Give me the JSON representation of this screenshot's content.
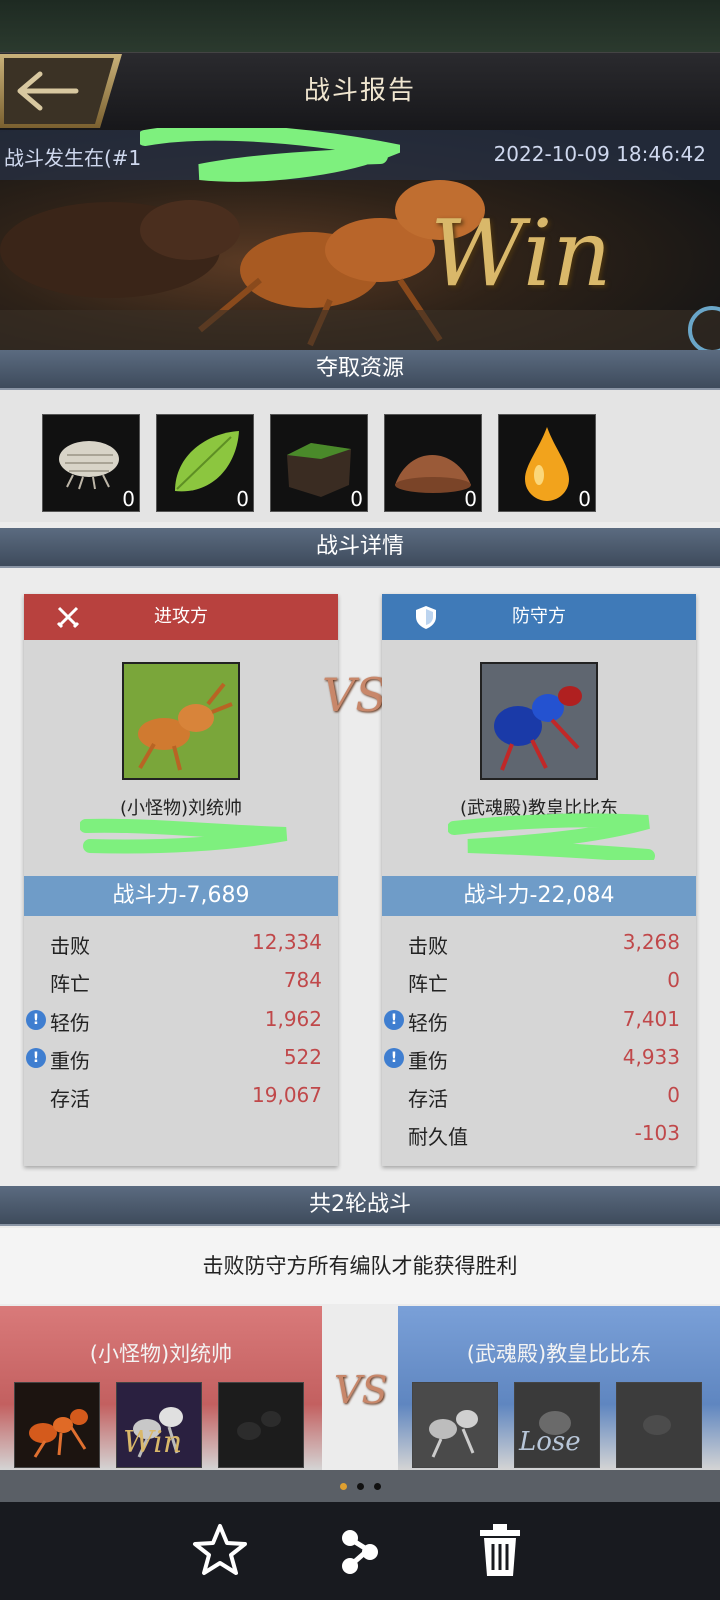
{
  "header": {
    "title": "战斗报告"
  },
  "battle": {
    "location": "战斗发生在(#1",
    "time": "2022-10-09 18:46:42",
    "result_banner": "Win"
  },
  "sections": {
    "loot": "夺取资源",
    "details": "战斗详情",
    "rounds": "共2轮战斗"
  },
  "resources": [
    {
      "icon": "pillbug-icon",
      "count": "0"
    },
    {
      "icon": "leaf-icon",
      "count": "0"
    },
    {
      "icon": "soil-icon",
      "count": "0"
    },
    {
      "icon": "sand-icon",
      "count": "0"
    },
    {
      "icon": "honeydew-drop-icon",
      "count": "0"
    }
  ],
  "attacker": {
    "side_label": "进攻方",
    "name": "(小怪物)刘统帅",
    "power": "战斗力-7,689",
    "stats": [
      {
        "label": "击败",
        "value": "12,334",
        "warn": false
      },
      {
        "label": "阵亡",
        "value": "784",
        "warn": false
      },
      {
        "label": "轻伤",
        "value": "1,962",
        "warn": true
      },
      {
        "label": "重伤",
        "value": "522",
        "warn": true
      },
      {
        "label": "存活",
        "value": "19,067",
        "warn": false
      }
    ]
  },
  "defender": {
    "side_label": "防守方",
    "name": "(武魂殿)教皇比比东",
    "power": "战斗力-22,084",
    "stats": [
      {
        "label": "击败",
        "value": "3,268",
        "warn": false
      },
      {
        "label": "阵亡",
        "value": "0",
        "warn": false
      },
      {
        "label": "轻伤",
        "value": "7,401",
        "warn": true
      },
      {
        "label": "重伤",
        "value": "4,933",
        "warn": true
      },
      {
        "label": "存活",
        "value": "0",
        "warn": false
      },
      {
        "label": "耐久值",
        "value": "-103",
        "warn": false
      }
    ]
  },
  "vs_label": "VS",
  "rounds": {
    "requirement": "击败防守方所有编队才能获得胜利",
    "attacker_team": "(小怪物)刘统帅",
    "defender_team": "(武魂殿)教皇比比东",
    "attacker_badge": "Win",
    "defender_badge": "Lose"
  },
  "colors": {
    "attacker_head": "#b8413e",
    "defender_head": "#3f7ab8",
    "stat_value": "#c0484a",
    "section_bar": "#4a5868"
  }
}
